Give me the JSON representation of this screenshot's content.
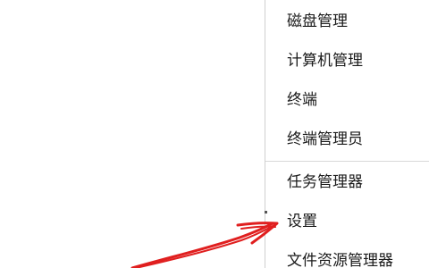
{
  "context_menu": {
    "items": [
      {
        "label": "磁盘管理"
      },
      {
        "label": "计算机管理"
      },
      {
        "label": "终端"
      },
      {
        "label": "终端管理员"
      },
      {
        "label": "任务管理器"
      },
      {
        "label": "设置"
      },
      {
        "label": "文件资源管理器"
      }
    ]
  },
  "annotation": {
    "type": "hand-drawn-arrow",
    "color": "#e01f1f",
    "points_to": "设置"
  }
}
